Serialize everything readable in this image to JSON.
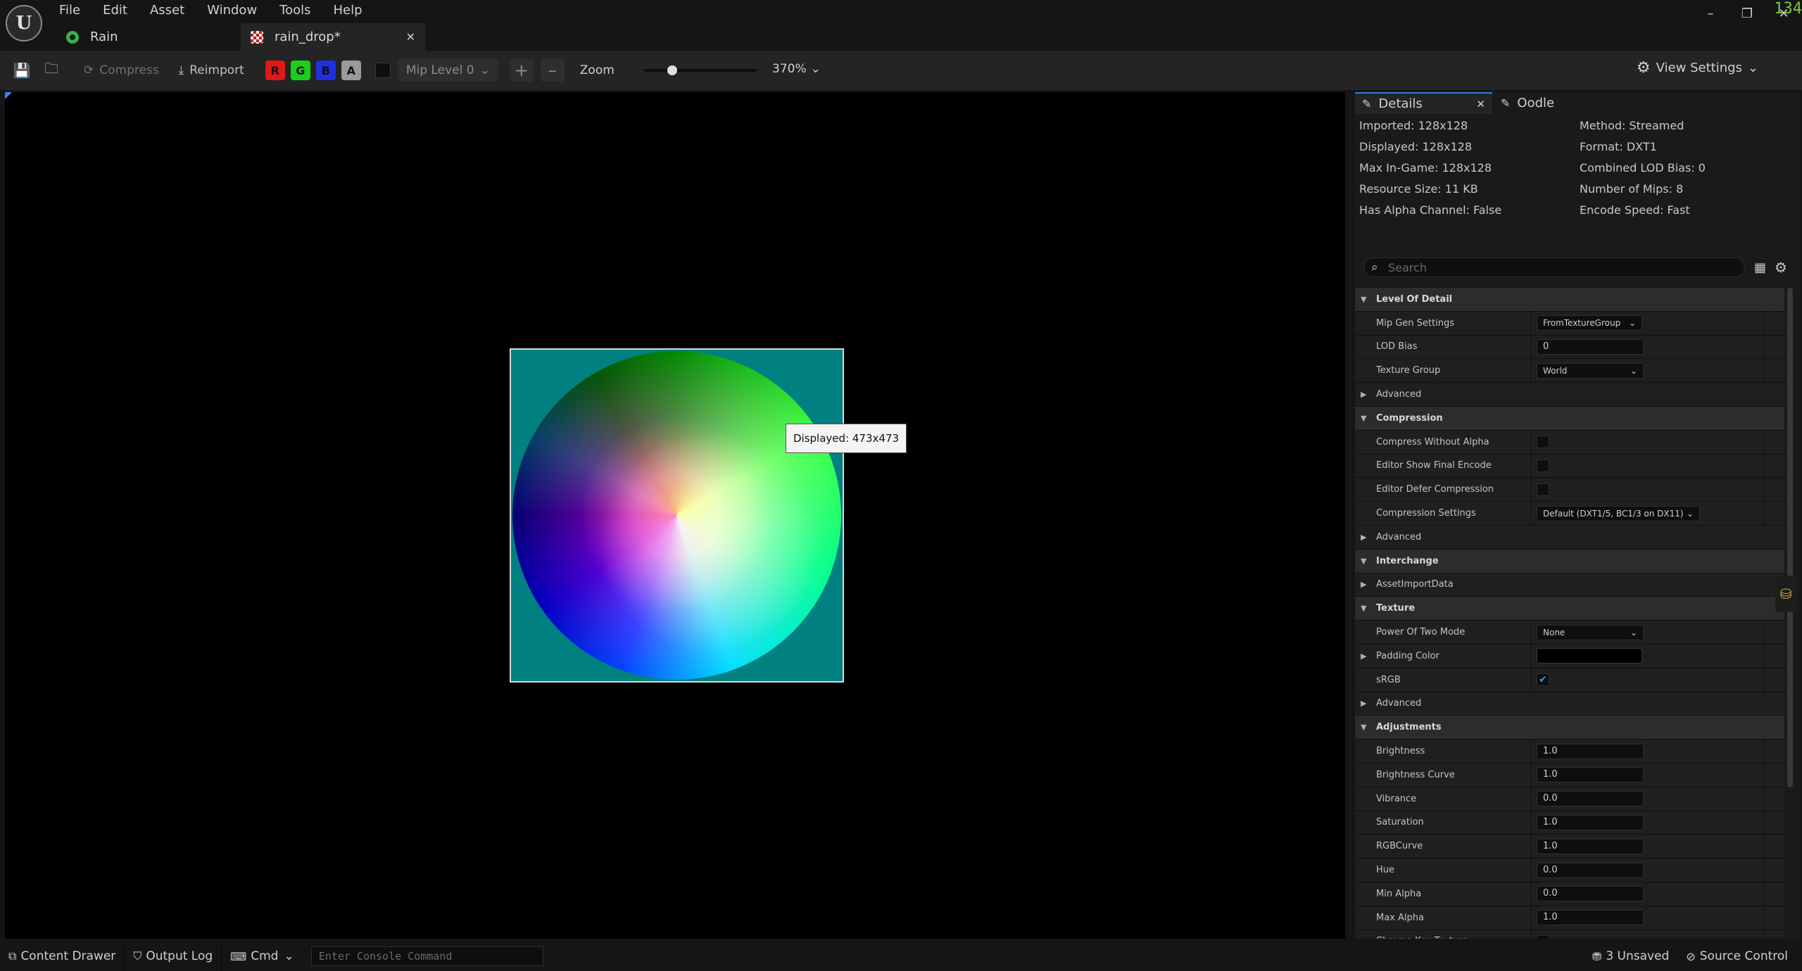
{
  "menu": [
    "File",
    "Edit",
    "Asset",
    "Window",
    "Tools",
    "Help"
  ],
  "tabs": [
    {
      "label": "Rain"
    },
    {
      "label": "rain_drop*"
    }
  ],
  "window": {
    "minimize": "–",
    "restore": "❐",
    "close": "✕",
    "corner_mark": "134"
  },
  "toolbar": {
    "compress": "Compress",
    "reimport": "Reimport",
    "channels": [
      {
        "label": "R",
        "color": "#e01818"
      },
      {
        "label": "G",
        "color": "#18d018"
      },
      {
        "label": "B",
        "color": "#2030e0"
      },
      {
        "label": "A",
        "color": "#9a9a9a"
      }
    ],
    "mip_level": "Mip Level 0",
    "zoom_label": "Zoom",
    "zoom_value": "370%",
    "view_settings": "View Settings"
  },
  "viewport": {
    "tooltip": "Displayed: 473x473",
    "background_color": "#008080"
  },
  "details": {
    "tabs": [
      "Details",
      "Oodle"
    ],
    "info_left": [
      "Imported: 128x128",
      "Displayed: 128x128",
      "Max In-Game: 128x128",
      "Resource Size: 11 KB",
      "Has Alpha Channel: False"
    ],
    "info_right": [
      "Method: Streamed",
      "Format: DXT1",
      "Combined LOD Bias: 0",
      "Number of Mips: 8",
      "Encode Speed: Fast"
    ],
    "search_placeholder": "Search",
    "properties": [
      {
        "type": "cat",
        "label": "Level Of Detail"
      },
      {
        "type": "dd",
        "label": "Mip Gen Settings",
        "value": "FromTextureGroup",
        "w": 150
      },
      {
        "type": "input",
        "label": "LOD Bias",
        "value": "0"
      },
      {
        "type": "dd",
        "label": "Texture Group",
        "value": "World",
        "w": 152
      },
      {
        "type": "sub",
        "label": "Advanced"
      },
      {
        "type": "cat",
        "label": "Compression"
      },
      {
        "type": "chk",
        "label": "Compress Without Alpha",
        "checked": false
      },
      {
        "type": "chk",
        "label": "Editor Show Final Encode",
        "checked": false
      },
      {
        "type": "chk",
        "label": "Editor Defer Compression",
        "checked": false
      },
      {
        "type": "dd",
        "label": "Compression Settings",
        "value": "Default (DXT1/5, BC1/3 on DX11)",
        "w": 232
      },
      {
        "type": "sub",
        "label": "Advanced"
      },
      {
        "type": "cat",
        "label": "Interchange"
      },
      {
        "type": "sub",
        "label": "AssetImportData"
      },
      {
        "type": "cat",
        "label": "Texture"
      },
      {
        "type": "dd",
        "label": "Power Of Two Mode",
        "value": "None",
        "w": 152
      },
      {
        "type": "color",
        "label": "Padding Color",
        "sublabel": true
      },
      {
        "type": "chk",
        "label": "sRGB",
        "checked": true
      },
      {
        "type": "sub",
        "label": "Advanced"
      },
      {
        "type": "cat",
        "label": "Adjustments"
      },
      {
        "type": "input",
        "label": "Brightness",
        "value": "1.0"
      },
      {
        "type": "input",
        "label": "Brightness Curve",
        "value": "1.0"
      },
      {
        "type": "input",
        "label": "Vibrance",
        "value": "0.0"
      },
      {
        "type": "input",
        "label": "Saturation",
        "value": "1.0"
      },
      {
        "type": "input",
        "label": "RGBCurve",
        "value": "1.0"
      },
      {
        "type": "input",
        "label": "Hue",
        "value": "0.0"
      },
      {
        "type": "input",
        "label": "Min Alpha",
        "value": "0.0"
      },
      {
        "type": "input",
        "label": "Max Alpha",
        "value": "1.0"
      },
      {
        "type": "chk",
        "label": "Chroma Key Texture",
        "checked": false
      }
    ]
  },
  "status": {
    "content_drawer": "Content Drawer",
    "output_log": "Output Log",
    "cmd": "Cmd",
    "console_placeholder": "Enter Console Command",
    "unsaved": "3 Unsaved",
    "source_control": "Source Control"
  }
}
